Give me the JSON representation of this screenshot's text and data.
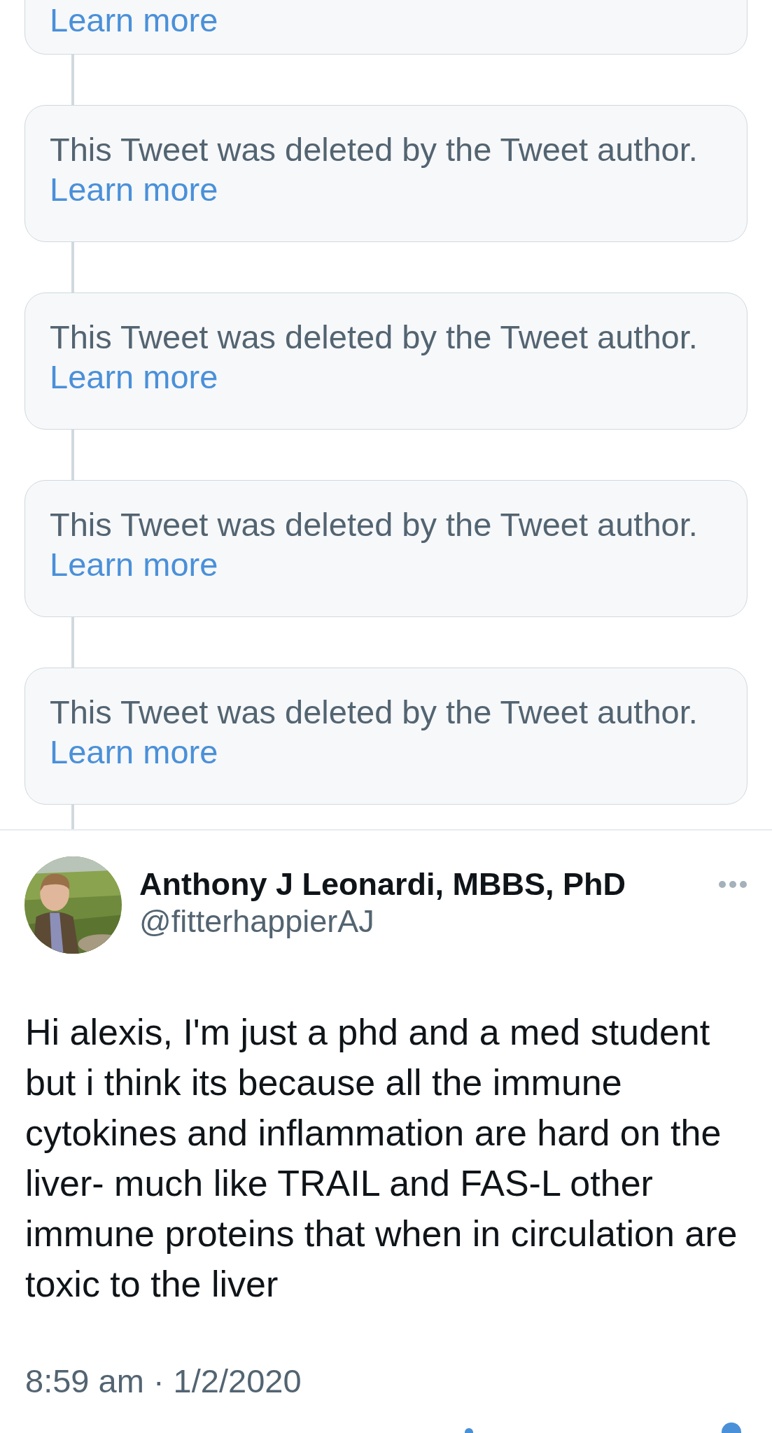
{
  "deleted_tweets": [
    {
      "link": "Learn more"
    },
    {
      "notice": "This Tweet was deleted by the Tweet author.",
      "link": "Learn more"
    },
    {
      "notice": "This Tweet was deleted by the Tweet author.",
      "link": "Learn more"
    },
    {
      "notice": "This Tweet was deleted by the Tweet author.",
      "link": "Learn more"
    },
    {
      "notice": "This Tweet was deleted by the Tweet author.",
      "link": "Learn more"
    }
  ],
  "tweet": {
    "author_name": "Anthony J Leonardi, MBBS, PhD",
    "handle": "@fitterhappierAJ",
    "text": "Hi alexis, I'm just a phd and a med student but i think its because all the immune cytokines and inflammation are hard on the liver- much like TRAIL and FAS-L other immune proteins that when in circulation are toxic to the liver",
    "timestamp": "8:59 am · 1/2/2020"
  }
}
